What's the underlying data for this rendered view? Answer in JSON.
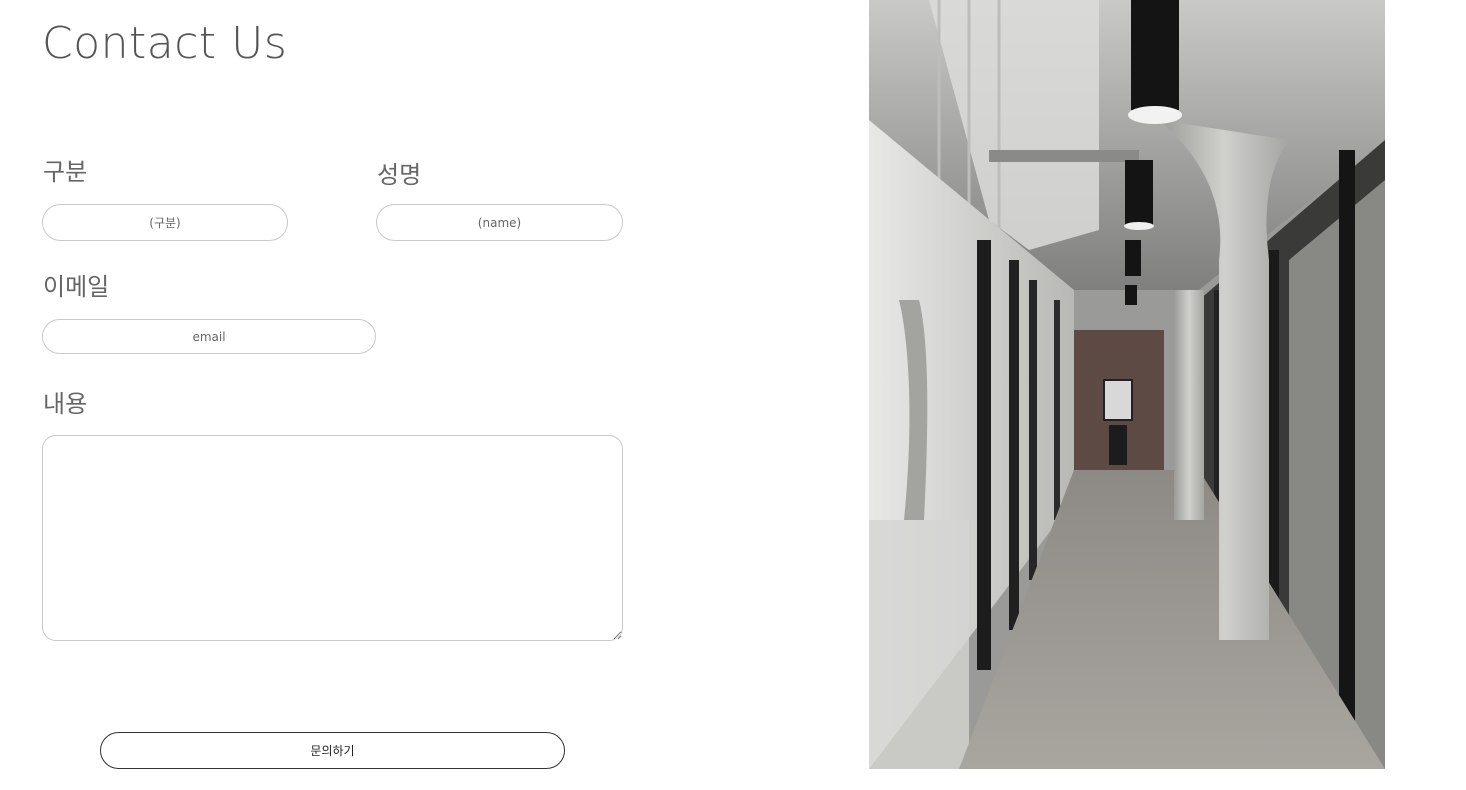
{
  "title": "Contact Us",
  "form": {
    "category": {
      "label": "구분",
      "placeholder": "(구분)",
      "value": ""
    },
    "name": {
      "label": "성명",
      "placeholder": "(name)",
      "value": ""
    },
    "email": {
      "label": "이메일",
      "placeholder": "email",
      "value": ""
    },
    "message": {
      "label": "내용",
      "value": ""
    },
    "submit_label": "문의하기"
  },
  "colors": {
    "title": "#555555",
    "border": "#c9c9c9",
    "button_border": "#333333"
  }
}
